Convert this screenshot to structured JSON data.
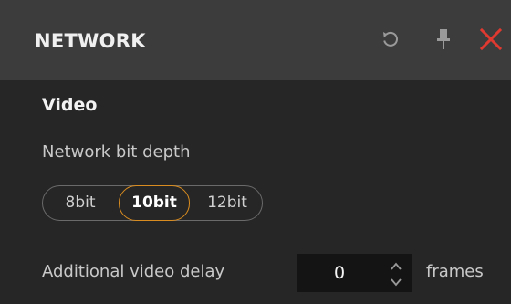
{
  "header": {
    "title": "NETWORK",
    "icons": {
      "reset": "reset-icon",
      "pin": "pin-icon",
      "close": "close-icon"
    },
    "close_color": "#e03a30"
  },
  "video": {
    "section_title": "Video",
    "bit_depth": {
      "label": "Network bit depth",
      "options": [
        "8bit",
        "10bit",
        "12bit"
      ],
      "selected": "10bit"
    },
    "delay": {
      "label": "Additional video delay",
      "value": "0",
      "units": "frames"
    }
  },
  "colors": {
    "accent": "#d98c20",
    "header_bg": "#3c3c3c",
    "body_bg": "#262626"
  }
}
